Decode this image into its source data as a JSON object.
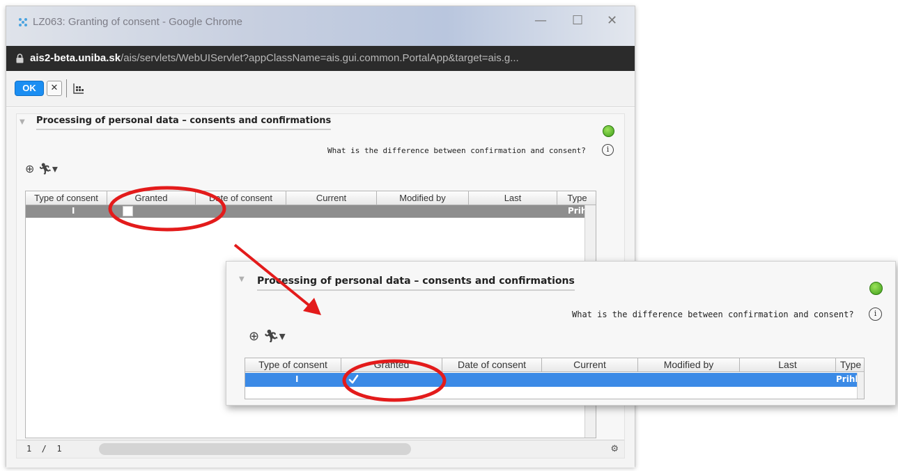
{
  "window": {
    "title": "LZ063: Granting of consent - Google Chrome",
    "url_host": "ais2-beta.uniba.sk",
    "url_path": "/ais/servlets/WebUIServlet?appClassName=ais.gui.common.PortalApp&target=ais.g...",
    "controls": {
      "minimize": "—",
      "maximize": "☐",
      "close": "✕"
    }
  },
  "toolbar": {
    "ok_label": "OK",
    "cancel_label": "✕"
  },
  "section": {
    "title": "Processing of personal data – consents and confirmations",
    "help_question": "What is the difference between confirmation and consent?",
    "info_glyph": "i"
  },
  "table": {
    "columns": [
      "Type of consent",
      "Granted",
      "Date of consent",
      "Current",
      "Modified by",
      "Last",
      "Type"
    ],
    "row": {
      "type_of_consent": "I",
      "type": "Prihl"
    },
    "pager": "1  /  1"
  },
  "zoom_table": {
    "columns": [
      "Type of consent",
      "Granted",
      "Date of consent",
      "Current",
      "Modified by",
      "Last",
      "Type"
    ],
    "row": {
      "type_of_consent": "I",
      "type": "Prihl"
    }
  },
  "colors": {
    "row_unselected": "#8e8e8e",
    "row_selected": "#3b8ae6",
    "ok_button": "#1b8ef2",
    "annotation": "#e31b1b"
  },
  "icons": [
    "app-icon",
    "lock-icon",
    "grid-icon",
    "zoom-in-icon",
    "runner-icon",
    "smiley-icon",
    "info-icon",
    "gear-icon",
    "checkmark-icon"
  ]
}
